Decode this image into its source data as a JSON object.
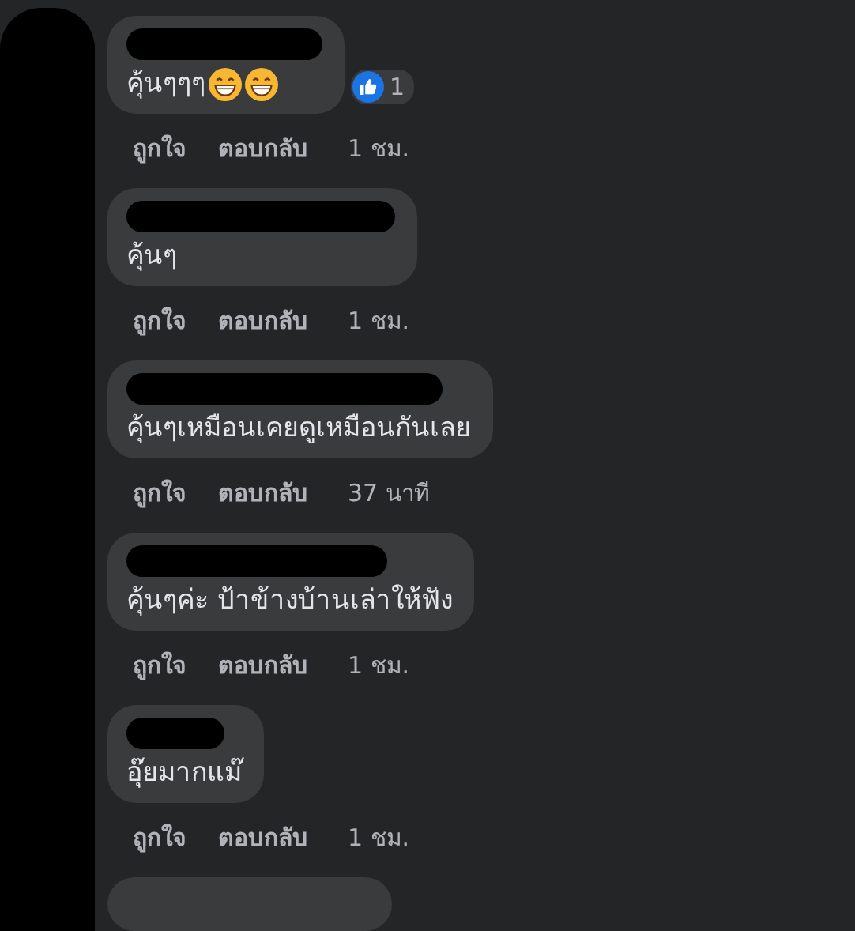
{
  "comments": [
    {
      "text": "คุ้นๆๆๆ",
      "emojis": [
        {
          "kind": "grin"
        },
        {
          "kind": "grin"
        }
      ],
      "reaction": {
        "count": "1"
      },
      "actions": [
        "ถูกใจ",
        "ตอบกลับ"
      ],
      "time": "1 ชม."
    },
    {
      "text": "คุ้นๆ",
      "actions": [
        "ถูกใจ",
        "ตอบกลับ"
      ],
      "time": "1 ชม."
    },
    {
      "text": "คุ้นๆเหมือนเคยดูเหมือนกันเลย",
      "actions": [
        "ถูกใจ",
        "ตอบกลับ"
      ],
      "time": "37 นาที"
    },
    {
      "text": "คุ้นๆค่ะ ป้าข้างบ้านเล่าให้ฟัง",
      "actions": [
        "ถูกใจ",
        "ตอบกลับ"
      ],
      "time": "1 ชม."
    },
    {
      "text": "อุ๊ยมากแม๊",
      "actions": [
        "ถูกใจ",
        "ตอบกลับ"
      ],
      "time": "1 ชม."
    }
  ]
}
